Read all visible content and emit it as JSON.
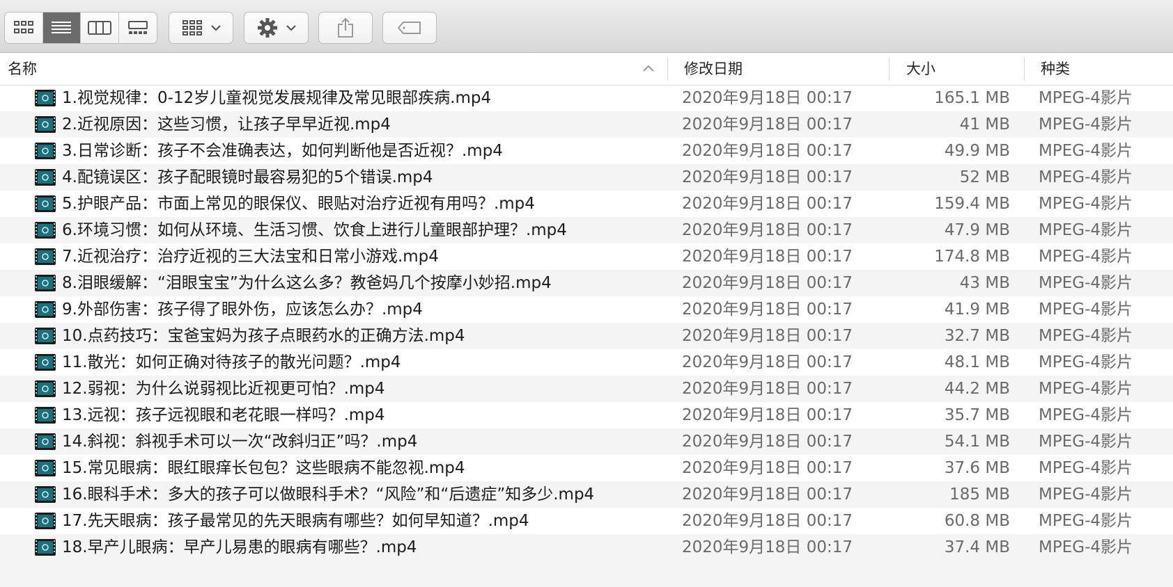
{
  "toolbar": {
    "view_buttons": [
      {
        "icon": "icon-view-icon",
        "active": false
      },
      {
        "icon": "list-view-icon",
        "active": true
      },
      {
        "icon": "column-view-icon",
        "active": false
      },
      {
        "icon": "gallery-view-icon",
        "active": false
      }
    ],
    "group_icon": "group-by-icon",
    "action_icon": "gear-icon",
    "share_icon": "share-icon",
    "tag_icon": "tag-icon"
  },
  "columns": {
    "name": "名称",
    "date": "修改日期",
    "size": "大小",
    "kind": "种类",
    "sort_indicator": "chevron-up-icon"
  },
  "files": [
    {
      "name": "1.视觉规律：0-12岁儿童视觉发展规律及常见眼部疾病.mp4",
      "date": "2020年9月18日 00:17",
      "size": "165.1 MB",
      "kind": "MPEG-4影片"
    },
    {
      "name": "2.近视原因：这些习惯，让孩子早早近视.mp4",
      "date": "2020年9月18日 00:17",
      "size": "41 MB",
      "kind": "MPEG-4影片"
    },
    {
      "name": "3.日常诊断：孩子不会准确表达，如何判断他是否近视？.mp4",
      "date": "2020年9月18日 00:17",
      "size": "49.9 MB",
      "kind": "MPEG-4影片"
    },
    {
      "name": "4.配镜误区：孩子配眼镜时最容易犯的5个错误.mp4",
      "date": "2020年9月18日 00:17",
      "size": "52 MB",
      "kind": "MPEG-4影片"
    },
    {
      "name": "5.护眼产品：市面上常见的眼保仪、眼贴对治疗近视有用吗？.mp4",
      "date": "2020年9月18日 00:17",
      "size": "159.4 MB",
      "kind": "MPEG-4影片"
    },
    {
      "name": "6.环境习惯：如何从环境、生活习惯、饮食上进行儿童眼部护理？.mp4",
      "date": "2020年9月18日 00:17",
      "size": "47.9 MB",
      "kind": "MPEG-4影片"
    },
    {
      "name": "7.近视治疗：治疗近视的三大法宝和日常小游戏.mp4",
      "date": "2020年9月18日 00:17",
      "size": "174.8 MB",
      "kind": "MPEG-4影片"
    },
    {
      "name": "8.泪眼缓解：“泪眼宝宝”为什么这么多？教爸妈几个按摩小妙招.mp4",
      "date": "2020年9月18日 00:17",
      "size": "43 MB",
      "kind": "MPEG-4影片"
    },
    {
      "name": "9.外部伤害：孩子得了眼外伤，应该怎么办？.mp4",
      "date": "2020年9月18日 00:17",
      "size": "41.9 MB",
      "kind": "MPEG-4影片"
    },
    {
      "name": "10.点药技巧：宝爸宝妈为孩子点眼药水的正确方法.mp4",
      "date": "2020年9月18日 00:17",
      "size": "32.7 MB",
      "kind": "MPEG-4影片"
    },
    {
      "name": "11.散光：如何正确对待孩子的散光问题？.mp4",
      "date": "2020年9月18日 00:17",
      "size": "48.1 MB",
      "kind": "MPEG-4影片"
    },
    {
      "name": "12.弱视：为什么说弱视比近视更可怕？.mp4",
      "date": "2020年9月18日 00:17",
      "size": "44.2 MB",
      "kind": "MPEG-4影片"
    },
    {
      "name": "13.远视：孩子远视眼和老花眼一样吗？.mp4",
      "date": "2020年9月18日 00:17",
      "size": "35.7 MB",
      "kind": "MPEG-4影片"
    },
    {
      "name": "14.斜视：斜视手术可以一次“改斜归正”吗？.mp4",
      "date": "2020年9月18日 00:17",
      "size": "54.1 MB",
      "kind": "MPEG-4影片"
    },
    {
      "name": "15.常见眼病：眼红眼痒长包包？这些眼病不能忽视.mp4",
      "date": "2020年9月18日 00:17",
      "size": "37.6 MB",
      "kind": "MPEG-4影片"
    },
    {
      "name": "16.眼科手术：多大的孩子可以做眼科手术？“风险”和“后遗症”知多少.mp4",
      "date": "2020年9月18日 00:17",
      "size": "185 MB",
      "kind": "MPEG-4影片"
    },
    {
      "name": "17.先天眼病：孩子最常见的先天眼病有哪些？如何早知道？.mp4",
      "date": "2020年9月18日 00:17",
      "size": "60.8 MB",
      "kind": "MPEG-4影片"
    },
    {
      "name": "18.早产儿眼病：早产儿易患的眼病有哪些？.mp4",
      "date": "2020年9月18日 00:17",
      "size": "37.4 MB",
      "kind": "MPEG-4影片"
    }
  ],
  "colors": {
    "alt_row": "#f4f4f4",
    "active_view": "#6b6b6b",
    "file_icon": "#1f6f7a"
  }
}
